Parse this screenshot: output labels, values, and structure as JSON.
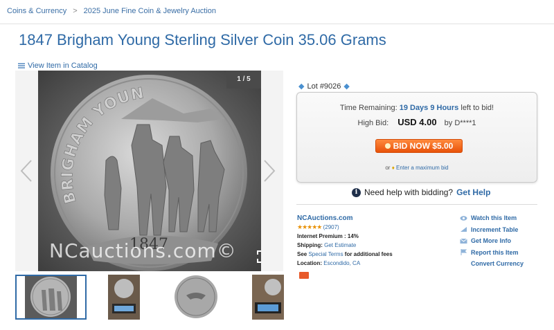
{
  "breadcrumb": {
    "items": [
      "Coins & Currency",
      "2025 June Fine Coin & Jewelry Auction"
    ],
    "separator": ">"
  },
  "title": "1847 Brigham Young Sterling Silver Coin 35.06 Grams",
  "catalog_link": "View Item in Catalog",
  "viewer": {
    "counter": "1 / 5",
    "watermark": "NCauctions.com©",
    "coin_text_top": "BRIGHAM YOUNG",
    "coin_text_year": "1847"
  },
  "lot": {
    "label": "Lot #9026"
  },
  "bid": {
    "time_label": "Time Remaining:",
    "time_value": "19 Days 9 Hours",
    "time_suffix": "left to bid!",
    "high_bid_label": "High Bid:",
    "high_bid_amount": "USD 4.00",
    "high_bid_by": "by D****1",
    "button_label": "BID NOW $5.00",
    "max_prefix": "or",
    "max_link": "Enter a maximum bid"
  },
  "help": {
    "text": "Need help with bidding?",
    "link": "Get Help"
  },
  "seller": {
    "name": "NCAuctions.com",
    "rating_count": "(2907)",
    "stars": 5,
    "premium": "Internet Premium : 14%",
    "shipping_label": "Shipping:",
    "shipping_link": "Get Estimate",
    "terms_pre": "See",
    "terms_link": "Special Terms",
    "terms_post": "for additional fees",
    "location_label": "Location:",
    "location_value": "Escondido, CA"
  },
  "actions": [
    "Watch this Item",
    "Increment Table",
    "Get More Info",
    "Report this Item",
    "Convert Currency"
  ],
  "colors": {
    "link": "#2f6aa6",
    "bid_button": "#e8520a",
    "star": "#e8920a"
  }
}
